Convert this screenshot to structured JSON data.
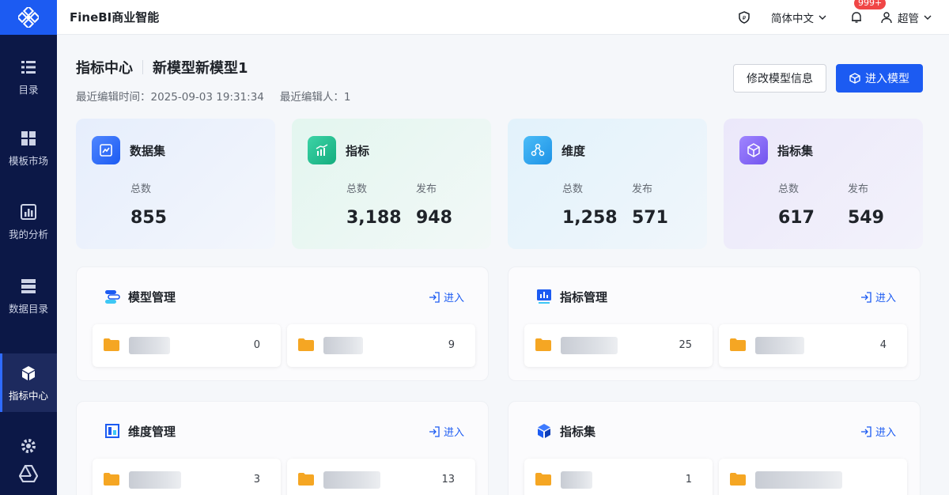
{
  "app": {
    "brand": "FineBI商业智能"
  },
  "sidebar": {
    "items": [
      {
        "label": "目录",
        "icon": "catalog-icon",
        "active": false
      },
      {
        "label": "模板市场",
        "icon": "template-market-icon",
        "active": false
      },
      {
        "label": "我的分析",
        "icon": "analysis-icon",
        "active": false
      },
      {
        "label": "数据目录",
        "icon": "data-catalog-icon",
        "active": false
      },
      {
        "label": "指标中心",
        "icon": "metric-center-icon",
        "active": true
      }
    ]
  },
  "topbar": {
    "language": "简体中文",
    "notification_badge": "999+",
    "user": "超管"
  },
  "header": {
    "breadcrumb": "指标中心",
    "model_name": "新模型新模型1",
    "last_edit_time": "最近编辑时间：2025-09-03 19:31:34",
    "last_editor": "最近编辑人：1",
    "edit_button": "修改模型信息",
    "enter_button": "进入模型"
  },
  "stats": [
    {
      "name": "数据集",
      "icon": "dataset-icon",
      "color": "#2f6bff",
      "labels": [
        "总数"
      ],
      "values": [
        "855"
      ]
    },
    {
      "name": "指标",
      "icon": "metric-icon",
      "color": "#1fbf8f",
      "labels": [
        "总数",
        "发布"
      ],
      "values": [
        "3,188",
        "948"
      ]
    },
    {
      "name": "维度",
      "icon": "dimension-icon",
      "color": "#2fa4f0",
      "labels": [
        "总数",
        "发布"
      ],
      "values": [
        "1,258",
        "571"
      ]
    },
    {
      "name": "指标集",
      "icon": "metric-set-icon",
      "color": "#8366f2",
      "labels": [
        "总数",
        "发布"
      ],
      "values": [
        "617",
        "549"
      ]
    }
  ],
  "panels": [
    {
      "title": "模型管理",
      "icon": "model-manage-icon",
      "enter": "进入",
      "files": [
        {
          "count": "0"
        },
        {
          "count": "9"
        }
      ]
    },
    {
      "title": "指标管理",
      "icon": "metric-manage-icon",
      "enter": "进入",
      "files": [
        {
          "count": "25"
        },
        {
          "count": "4"
        }
      ]
    },
    {
      "title": "维度管理",
      "icon": "dimension-manage-icon",
      "enter": "进入",
      "files": [
        {
          "count": "3"
        },
        {
          "count": "13"
        }
      ]
    },
    {
      "title": "指标集",
      "icon": "metric-set-cube-icon",
      "enter": "进入",
      "files": [
        {
          "count": "1"
        },
        {
          "count": ""
        }
      ]
    }
  ],
  "colors": {
    "primary": "#1c5bf2",
    "sidebar": "#0c1847",
    "folder": "#f5a623"
  }
}
